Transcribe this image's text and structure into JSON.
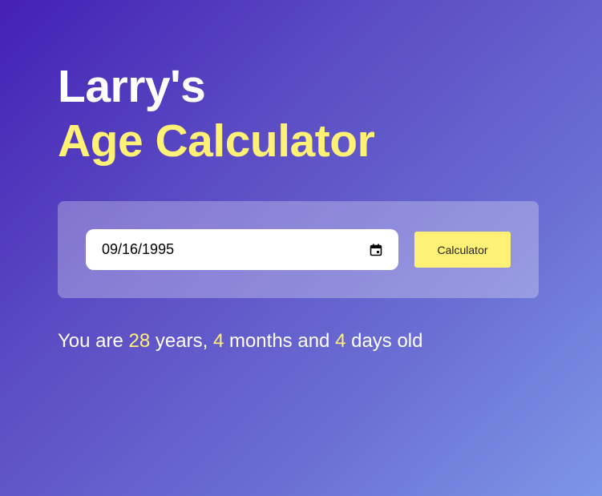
{
  "header": {
    "title_line1": "Larry's",
    "title_line2": "Age Calculator"
  },
  "form": {
    "date_value": "09/16/1995",
    "button_label": "Calculator",
    "calendar_icon": "calendar-icon"
  },
  "result": {
    "prefix": "You are",
    "years": "28",
    "years_label": "years,",
    "months": "4",
    "months_label": "months and",
    "days": "4",
    "days_label": "days old"
  },
  "colors": {
    "accent": "#fff176",
    "gradient_start": "#4420b4",
    "gradient_end": "#7d96e6",
    "text": "#ffffff"
  }
}
